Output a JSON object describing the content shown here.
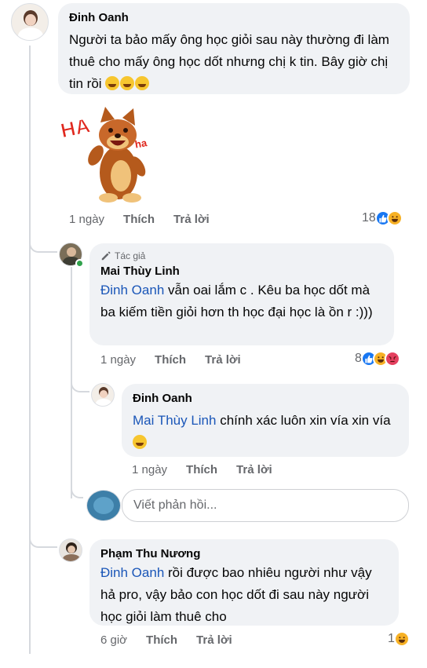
{
  "comments": [
    {
      "author": "Đinh Oanh",
      "text": "Người ta bảo mấy ông học giỏi sau này thường đi làm thuê cho mấy ông học dốt nhưng chị k tin. Bây giờ chị tin rồi",
      "emoji_count": 3,
      "emoji": "rofl",
      "sticker": "HA HA dog sticker",
      "time": "1 ngày",
      "like_label": "Thích",
      "reply_label": "Trả lời",
      "reaction_count": "18",
      "reactions": [
        "like",
        "haha"
      ]
    },
    {
      "badge": "Tác giả",
      "author": "Mai Thùy Linh",
      "mention": "Đinh Oanh",
      "text": " vẫn oai lắm c . Kêu ba học dốt mà ba kiếm tiền giỏi hơn th học đại học là ồn r :)))",
      "time": "1 ngày",
      "like_label": "Thích",
      "reply_label": "Trả lời",
      "reaction_count": "8",
      "reactions": [
        "like",
        "haha",
        "angry"
      ]
    },
    {
      "author": "Đinh Oanh",
      "mention": "Mai Thùy Linh",
      "text": " chính xác luôn xin vía xin vía",
      "emoji": "grin",
      "time": "1 ngày",
      "like_label": "Thích",
      "reply_label": "Trả lời"
    },
    {
      "author": "Phạm Thu Nương",
      "mention": "Đinh Oanh",
      "text": " rồi được bao nhiêu người như vậy hả pro, vậy bảo con học dốt đi sau này người học giỏi làm thuê cho",
      "time": "6 giờ",
      "like_label": "Thích",
      "reply_label": "Trả lời",
      "reaction_count": "1",
      "reactions": [
        "haha"
      ]
    }
  ],
  "reply_box": {
    "placeholder": "Viết phản hồi..."
  },
  "colors": {
    "bubble": "#f0f2f5",
    "mention": "#1a56b8",
    "muted": "#65676b",
    "like": "#1877f2",
    "haha": "#f7b125"
  }
}
